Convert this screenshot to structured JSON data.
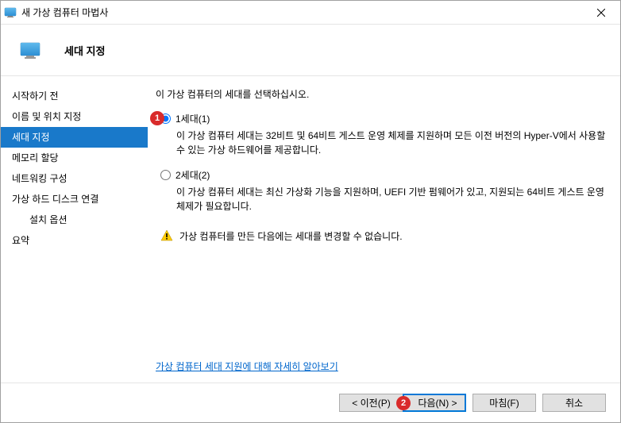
{
  "titlebar": {
    "title": "새 가상 컴퓨터 마법사"
  },
  "header": {
    "title": "세대 지정"
  },
  "sidebar": {
    "items": [
      {
        "label": "시작하기 전"
      },
      {
        "label": "이름 및 위치 지정"
      },
      {
        "label": "세대 지정"
      },
      {
        "label": "메모리 할당"
      },
      {
        "label": "네트워킹 구성"
      },
      {
        "label": "가상 하드 디스크 연결"
      },
      {
        "label": "설치 옵션"
      },
      {
        "label": "요약"
      }
    ]
  },
  "content": {
    "instruction": "이 가상 컴퓨터의 세대를 선택하십시오.",
    "gen1": {
      "label": "1세대(1)",
      "desc": "이 가상 컴퓨터 세대는 32비트 및 64비트 게스트 운영 체제를 지원하며 모든 이전 버전의 Hyper-V에서 사용할 수 있는 가상 하드웨어를 제공합니다."
    },
    "gen2": {
      "label": "2세대(2)",
      "desc": "이 가상 컴퓨터 세대는 최신 가상화 기능을 지원하며, UEFI 기반 펌웨어가 있고, 지원되는 64비트 게스트 운영 체제가 필요합니다."
    },
    "warning": "가상 컴퓨터를 만든 다음에는 세대를 변경할 수 없습니다.",
    "link": "가상 컴퓨터 세대 지원에 대해 자세히 알아보기"
  },
  "footer": {
    "prev": "< 이전(P)",
    "next": "다음(N) >",
    "finish": "마침(F)",
    "cancel": "취소"
  },
  "annot": {
    "a1": "1",
    "a2": "2"
  }
}
